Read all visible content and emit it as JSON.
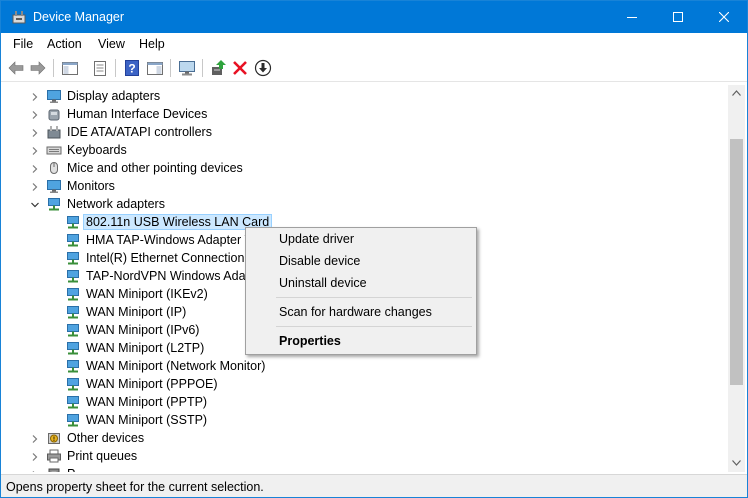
{
  "window": {
    "title": "Device Manager",
    "controls": {
      "minimize": "minimize",
      "maximize": "maximize",
      "close": "close"
    }
  },
  "menu": [
    "File",
    "Action",
    "View",
    "Help"
  ],
  "toolbar": {
    "buttons": [
      "back-arrow-icon",
      "forward-arrow-icon",
      "console-tree-icon",
      "properties-sheet-icon",
      "help-icon",
      "action-pane-icon",
      "monitor-icon",
      "update-driver-icon",
      "uninstall-x-icon",
      "download-arrow-icon"
    ]
  },
  "tree": {
    "items": [
      {
        "label": "Display adapters",
        "level": 0,
        "expanded": false,
        "icon": "display-adapter-icon"
      },
      {
        "label": "Human Interface Devices",
        "level": 0,
        "expanded": false,
        "icon": "hid-icon"
      },
      {
        "label": "IDE ATA/ATAPI controllers",
        "level": 0,
        "expanded": false,
        "icon": "ide-controller-icon"
      },
      {
        "label": "Keyboards",
        "level": 0,
        "expanded": false,
        "icon": "keyboard-icon"
      },
      {
        "label": "Mice and other pointing devices",
        "level": 0,
        "expanded": false,
        "icon": "mouse-icon"
      },
      {
        "label": "Monitors",
        "level": 0,
        "expanded": false,
        "icon": "monitor-icon"
      },
      {
        "label": "Network adapters",
        "level": 0,
        "expanded": true,
        "icon": "network-adapter-icon"
      },
      {
        "label": "802.11n USB Wireless LAN Card",
        "level": 1,
        "selected": true,
        "icon": "network-adapter-icon"
      },
      {
        "label": "HMA TAP-Windows Adapter V",
        "level": 1,
        "icon": "network-adapter-icon"
      },
      {
        "label": "Intel(R) Ethernet Connection I2",
        "level": 1,
        "icon": "network-adapter-icon"
      },
      {
        "label": "TAP-NordVPN Windows Adap",
        "level": 1,
        "icon": "network-adapter-icon"
      },
      {
        "label": "WAN Miniport (IKEv2)",
        "level": 1,
        "icon": "network-adapter-icon"
      },
      {
        "label": "WAN Miniport (IP)",
        "level": 1,
        "icon": "network-adapter-icon"
      },
      {
        "label": "WAN Miniport (IPv6)",
        "level": 1,
        "icon": "network-adapter-icon"
      },
      {
        "label": "WAN Miniport (L2TP)",
        "level": 1,
        "icon": "network-adapter-icon"
      },
      {
        "label": "WAN Miniport (Network Monitor)",
        "level": 1,
        "icon": "network-adapter-icon"
      },
      {
        "label": "WAN Miniport (PPPOE)",
        "level": 1,
        "icon": "network-adapter-icon"
      },
      {
        "label": "WAN Miniport (PPTP)",
        "level": 1,
        "icon": "network-adapter-icon"
      },
      {
        "label": "WAN Miniport (SSTP)",
        "level": 1,
        "icon": "network-adapter-icon"
      },
      {
        "label": "Other devices",
        "level": 0,
        "expanded": false,
        "icon": "other-devices-icon"
      },
      {
        "label": "Print queues",
        "level": 0,
        "expanded": false,
        "icon": "printer-icon"
      },
      {
        "label": "P",
        "level": 0,
        "expanded": false,
        "icon": "processor-icon"
      }
    ]
  },
  "context_menu": {
    "items": [
      {
        "label": "Update driver",
        "bold": false
      },
      {
        "label": "Disable device",
        "bold": false
      },
      {
        "label": "Uninstall device",
        "bold": false
      },
      {
        "separator": true
      },
      {
        "label": "Scan for hardware changes",
        "bold": false
      },
      {
        "separator": true
      },
      {
        "label": "Properties",
        "bold": true
      }
    ]
  },
  "status": {
    "text": "Opens property sheet for the current selection."
  },
  "colors": {
    "title_bar": "#0078d7",
    "selection": "#cce8ff",
    "selection_border": "#99d1ff",
    "menu_bg": "#f0f0f0"
  }
}
